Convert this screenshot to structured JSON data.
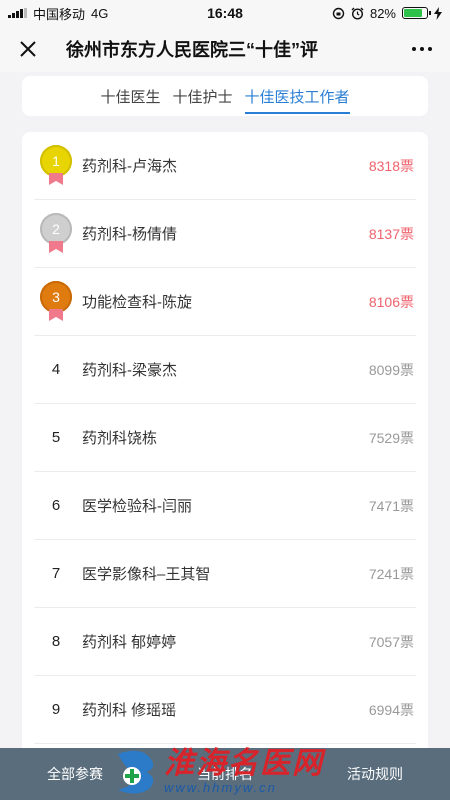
{
  "status_bar": {
    "carrier": "中国移动",
    "network": "4G",
    "time": "16:48",
    "battery": "82%",
    "battery_level": 0.82
  },
  "nav": {
    "title": "徐州市东方人民医院三“十佳”评"
  },
  "tabs": [
    {
      "label": "十佳医生",
      "active": false
    },
    {
      "label": "十佳护士",
      "active": false
    },
    {
      "label": "十佳医技工作者",
      "active": true
    }
  ],
  "ranking": [
    {
      "rank": "1",
      "name": "药剂科-卢海杰",
      "votes": "8318票",
      "medal": "gold"
    },
    {
      "rank": "2",
      "name": "药剂科-杨倩倩",
      "votes": "8137票",
      "medal": "silver"
    },
    {
      "rank": "3",
      "name": "功能检查科-陈旋",
      "votes": "8106票",
      "medal": "bronze"
    },
    {
      "rank": "4",
      "name": "药剂科-梁豪杰",
      "votes": "8099票"
    },
    {
      "rank": "5",
      "name": "药剂科饶栋",
      "votes": "7529票"
    },
    {
      "rank": "6",
      "name": "医学检验科-闫丽",
      "votes": "7471票"
    },
    {
      "rank": "7",
      "name": "医学影像科–王其智",
      "votes": "7241票"
    },
    {
      "rank": "8",
      "name": "药剂科 郁婷婷",
      "votes": "7057票"
    },
    {
      "rank": "9",
      "name": "药剂科 修瑶瑶",
      "votes": "6994票"
    }
  ],
  "bottom_bar": {
    "all_entries": "全部参赛",
    "current_ranking": "当前排名",
    "rules": "活动规则"
  },
  "watermark": {
    "title": "淮海名医网",
    "url": "www.hhmyw.cn"
  },
  "colors": {
    "accent": "#2a7fd4",
    "top_votes": "#f0626c",
    "gold": "#e8d400",
    "silver": "#c8c8c8",
    "bronze": "#e07b10",
    "ribbon": "#f07a8c",
    "bottom_bar": "#5a6d7c"
  }
}
